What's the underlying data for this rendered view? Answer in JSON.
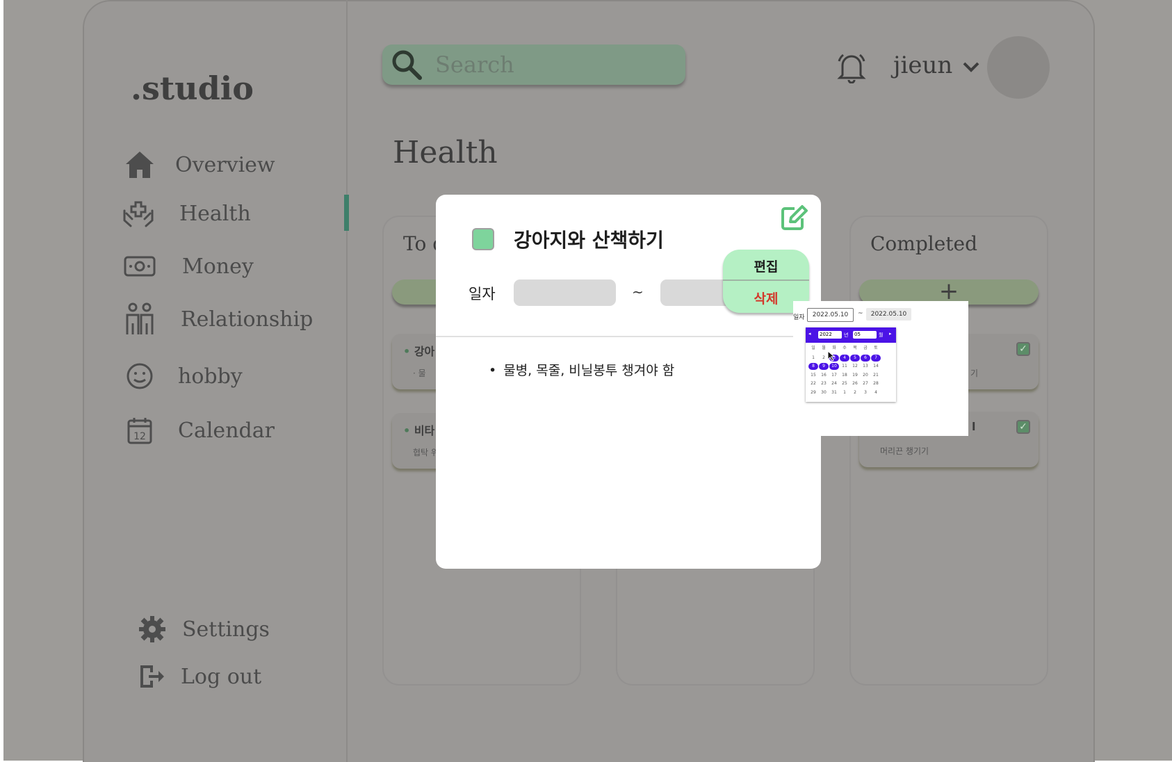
{
  "app": {
    "logo": ".studio"
  },
  "sidebar": {
    "items": [
      {
        "label": "Overview",
        "icon": "home-icon"
      },
      {
        "label": "Health",
        "icon": "health-hands-icon",
        "active": true
      },
      {
        "label": "Money",
        "icon": "money-icon"
      },
      {
        "label": "Relationship",
        "icon": "people-icon"
      },
      {
        "label": "hobby",
        "icon": "smile-icon"
      },
      {
        "label": "Calendar",
        "icon": "calendar-icon"
      }
    ],
    "settings_label": "Settings",
    "logout_label": "Log out"
  },
  "header": {
    "search_placeholder": "Search",
    "username": "jieun"
  },
  "main": {
    "title": "Health",
    "columns": [
      {
        "title": "To d",
        "cards": [
          {
            "title": "강아",
            "body": "· 물"
          },
          {
            "title": "비타",
            "body": "협탁 위"
          }
        ]
      },
      {
        "title": "",
        "cards": []
      },
      {
        "title": "Completed",
        "add_label": "+",
        "cards": [
          {
            "title": "",
            "body": "기",
            "checked": true
          },
          {
            "title": "l",
            "body": "머리끈 챙기기",
            "checked": true
          }
        ]
      }
    ]
  },
  "modal": {
    "task_title": "강아지와  산책하기",
    "swatch_color": "#7ed49c",
    "date_label": "일자",
    "date_separator": "~",
    "note_bullet": "•",
    "note": "물병, 목줄, 비닐봉투 챙겨야 함"
  },
  "action_menu": {
    "edit_label": "편집",
    "delete_label": "삭제"
  },
  "date_picker": {
    "label": "일자",
    "start_date": "2022.05.10",
    "separator": "~",
    "end_date": "2022.05.10",
    "year": "2022",
    "year_suffix": "년",
    "month": "05",
    "month_suffix": "월",
    "weekdays": [
      "일",
      "월",
      "화",
      "수",
      "목",
      "금",
      "토"
    ],
    "weeks": [
      [
        "1",
        "2",
        "3",
        "4",
        "5",
        "6",
        "7"
      ],
      [
        "8",
        "9",
        "10",
        "11",
        "12",
        "13",
        "14"
      ],
      [
        "15",
        "16",
        "17",
        "18",
        "19",
        "20",
        "21"
      ],
      [
        "22",
        "23",
        "24",
        "25",
        "26",
        "27",
        "28"
      ],
      [
        "29",
        "30",
        "31",
        "1",
        "2",
        "3",
        "4"
      ]
    ],
    "highlighted_days": [
      "3",
      "4",
      "5",
      "6",
      "7",
      "8",
      "9",
      "10"
    ]
  }
}
